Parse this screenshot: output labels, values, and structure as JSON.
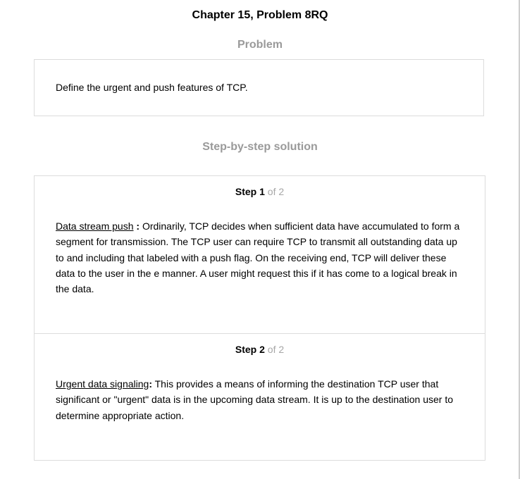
{
  "page": {
    "title": "Chapter 15, Problem 8RQ"
  },
  "problem": {
    "heading": "Problem",
    "text": "Define the urgent and push features of TCP."
  },
  "solution": {
    "heading": "Step-by-step solution",
    "steps": [
      {
        "label": "Step",
        "number": "1",
        "of_text": "of 2",
        "term": "Data stream push",
        "colon": " :",
        "body": " Ordinarily, TCP decides when sufficient data have accumulated to form a segment for transmission. The TCP user can require TCP to transmit all outstanding data up to and including that labeled with a push flag. On the receiving end, TCP will deliver these data to the user in the e manner. A user might request this if it has come to a logical break in the data."
      },
      {
        "label": "Step",
        "number": "2",
        "of_text": "of 2",
        "term": "Urgent data signaling",
        "colon": ":",
        "body": " This provides a means of informing the destination TCP user that significant or \"urgent\" data is in the upcoming data stream. It is up to the destination user to determine appropriate action."
      }
    ]
  }
}
